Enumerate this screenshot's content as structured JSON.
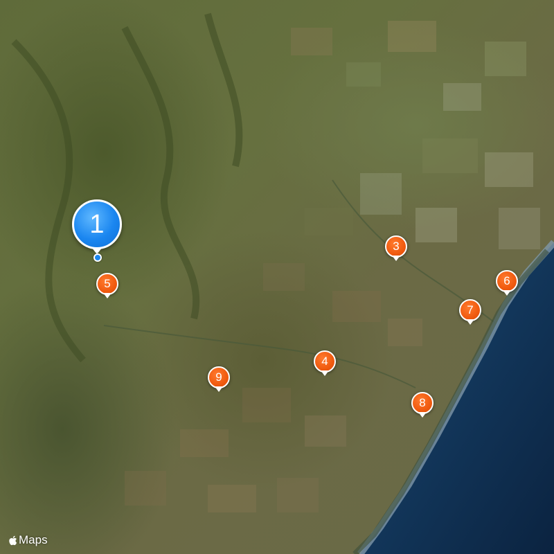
{
  "map": {
    "style": "satellite",
    "colors": {
      "land": "#66703f",
      "sea": "#0e2a4a",
      "coast": "#6f8aa0",
      "pin_primary": "#1a86f0",
      "pin_secondary": "#f05a0f"
    }
  },
  "markers": [
    {
      "label": "1",
      "kind": "primary",
      "icon": "location-pin-icon"
    },
    {
      "label": "3",
      "kind": "secondary",
      "icon": "location-pin-icon"
    },
    {
      "label": "4",
      "kind": "secondary",
      "icon": "location-pin-icon"
    },
    {
      "label": "5",
      "kind": "secondary",
      "icon": "location-pin-icon"
    },
    {
      "label": "6",
      "kind": "secondary",
      "icon": "location-pin-icon"
    },
    {
      "label": "7",
      "kind": "secondary",
      "icon": "location-pin-icon"
    },
    {
      "label": "8",
      "kind": "secondary",
      "icon": "location-pin-icon"
    },
    {
      "label": "9",
      "kind": "secondary",
      "icon": "location-pin-icon"
    }
  ],
  "attribution": {
    "icon": "apple-logo-icon",
    "text": "Maps"
  }
}
